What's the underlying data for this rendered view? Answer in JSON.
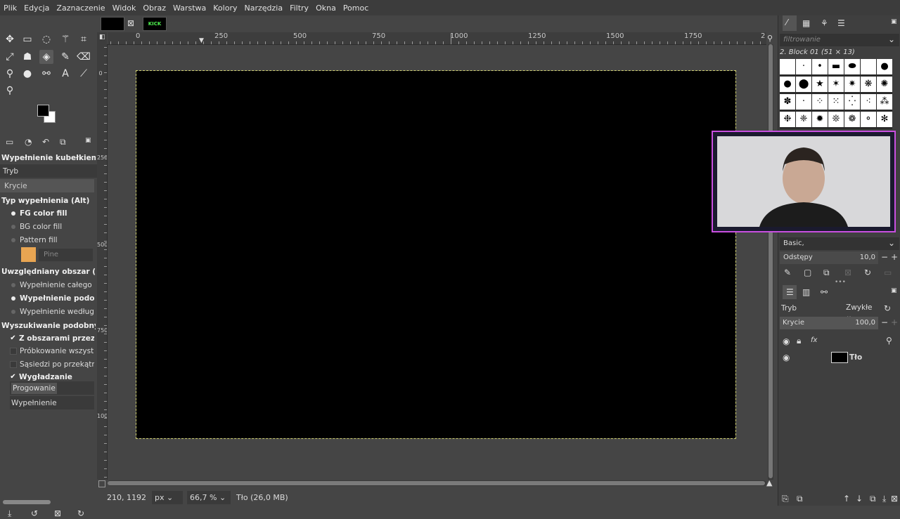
{
  "menubar": [
    "Plik",
    "Edycja",
    "Zaznaczenie",
    "Widok",
    "Obraz",
    "Warstwa",
    "Kolory",
    "Narzędzia",
    "Filtry",
    "Okna",
    "Pomoc"
  ],
  "image_tabs": [
    {
      "label": ""
    },
    {
      "label": "KICK"
    }
  ],
  "tool_options": {
    "title": "Wypełnienie kubełkiem",
    "mode_label": "Tryb",
    "opacity_label": "Krycie",
    "fill_type_heading": "Typ wypełnienia  (Alt)",
    "fill_types": [
      "FG color fill",
      "BG color fill",
      "Pattern fill"
    ],
    "selected_fill_type": 0,
    "pattern_name": "Pine",
    "area_heading": "Uwzględniany obszar  (Shift)",
    "areas": [
      "Wypełnienie całego zaz",
      "Wypełnienie podobnyc",
      "Wypełnienie według wy"
    ],
    "selected_area": 1,
    "similar_heading": "Wyszukiwanie podobnych ko",
    "similar_options": [
      {
        "label": "Z obszarami przezrocz",
        "checked": true
      },
      {
        "label": "Próbkowanie wszystkich",
        "checked": false
      },
      {
        "label": "Sąsiedzi po przekątnej",
        "checked": false
      },
      {
        "label": "Wygładzanie",
        "checked": true
      }
    ],
    "threshold_label": "Progowanie",
    "fill_by_label": "Wypełnienie"
  },
  "rulers": {
    "h_labels": [
      "0",
      "250",
      "500",
      "750",
      "1000",
      "1250",
      "1500",
      "1750",
      "2"
    ],
    "v_labels": [
      "0",
      "250",
      "500",
      "750",
      "1000"
    ]
  },
  "status": {
    "coords": "210, 1192",
    "unit": "px",
    "zoom": "66,7 %",
    "info": "Tło (26,0 MB)"
  },
  "brushes": {
    "filter_placeholder": "filtrowanie",
    "current": "2. Block 01 (51 × 13)",
    "preset": "Basic,",
    "spacing_label": "Odstępy",
    "spacing_value": "10,0"
  },
  "layers": {
    "mode_label": "Tryb",
    "mode_value": "Zwykłe",
    "opacity_label": "Krycie",
    "opacity_value": "100,0",
    "items": [
      {
        "name": "Tło",
        "visible": true
      }
    ]
  },
  "colors": {
    "accent": "#c94fe0",
    "canvas": "#000000",
    "selection": "#cfcf70"
  }
}
